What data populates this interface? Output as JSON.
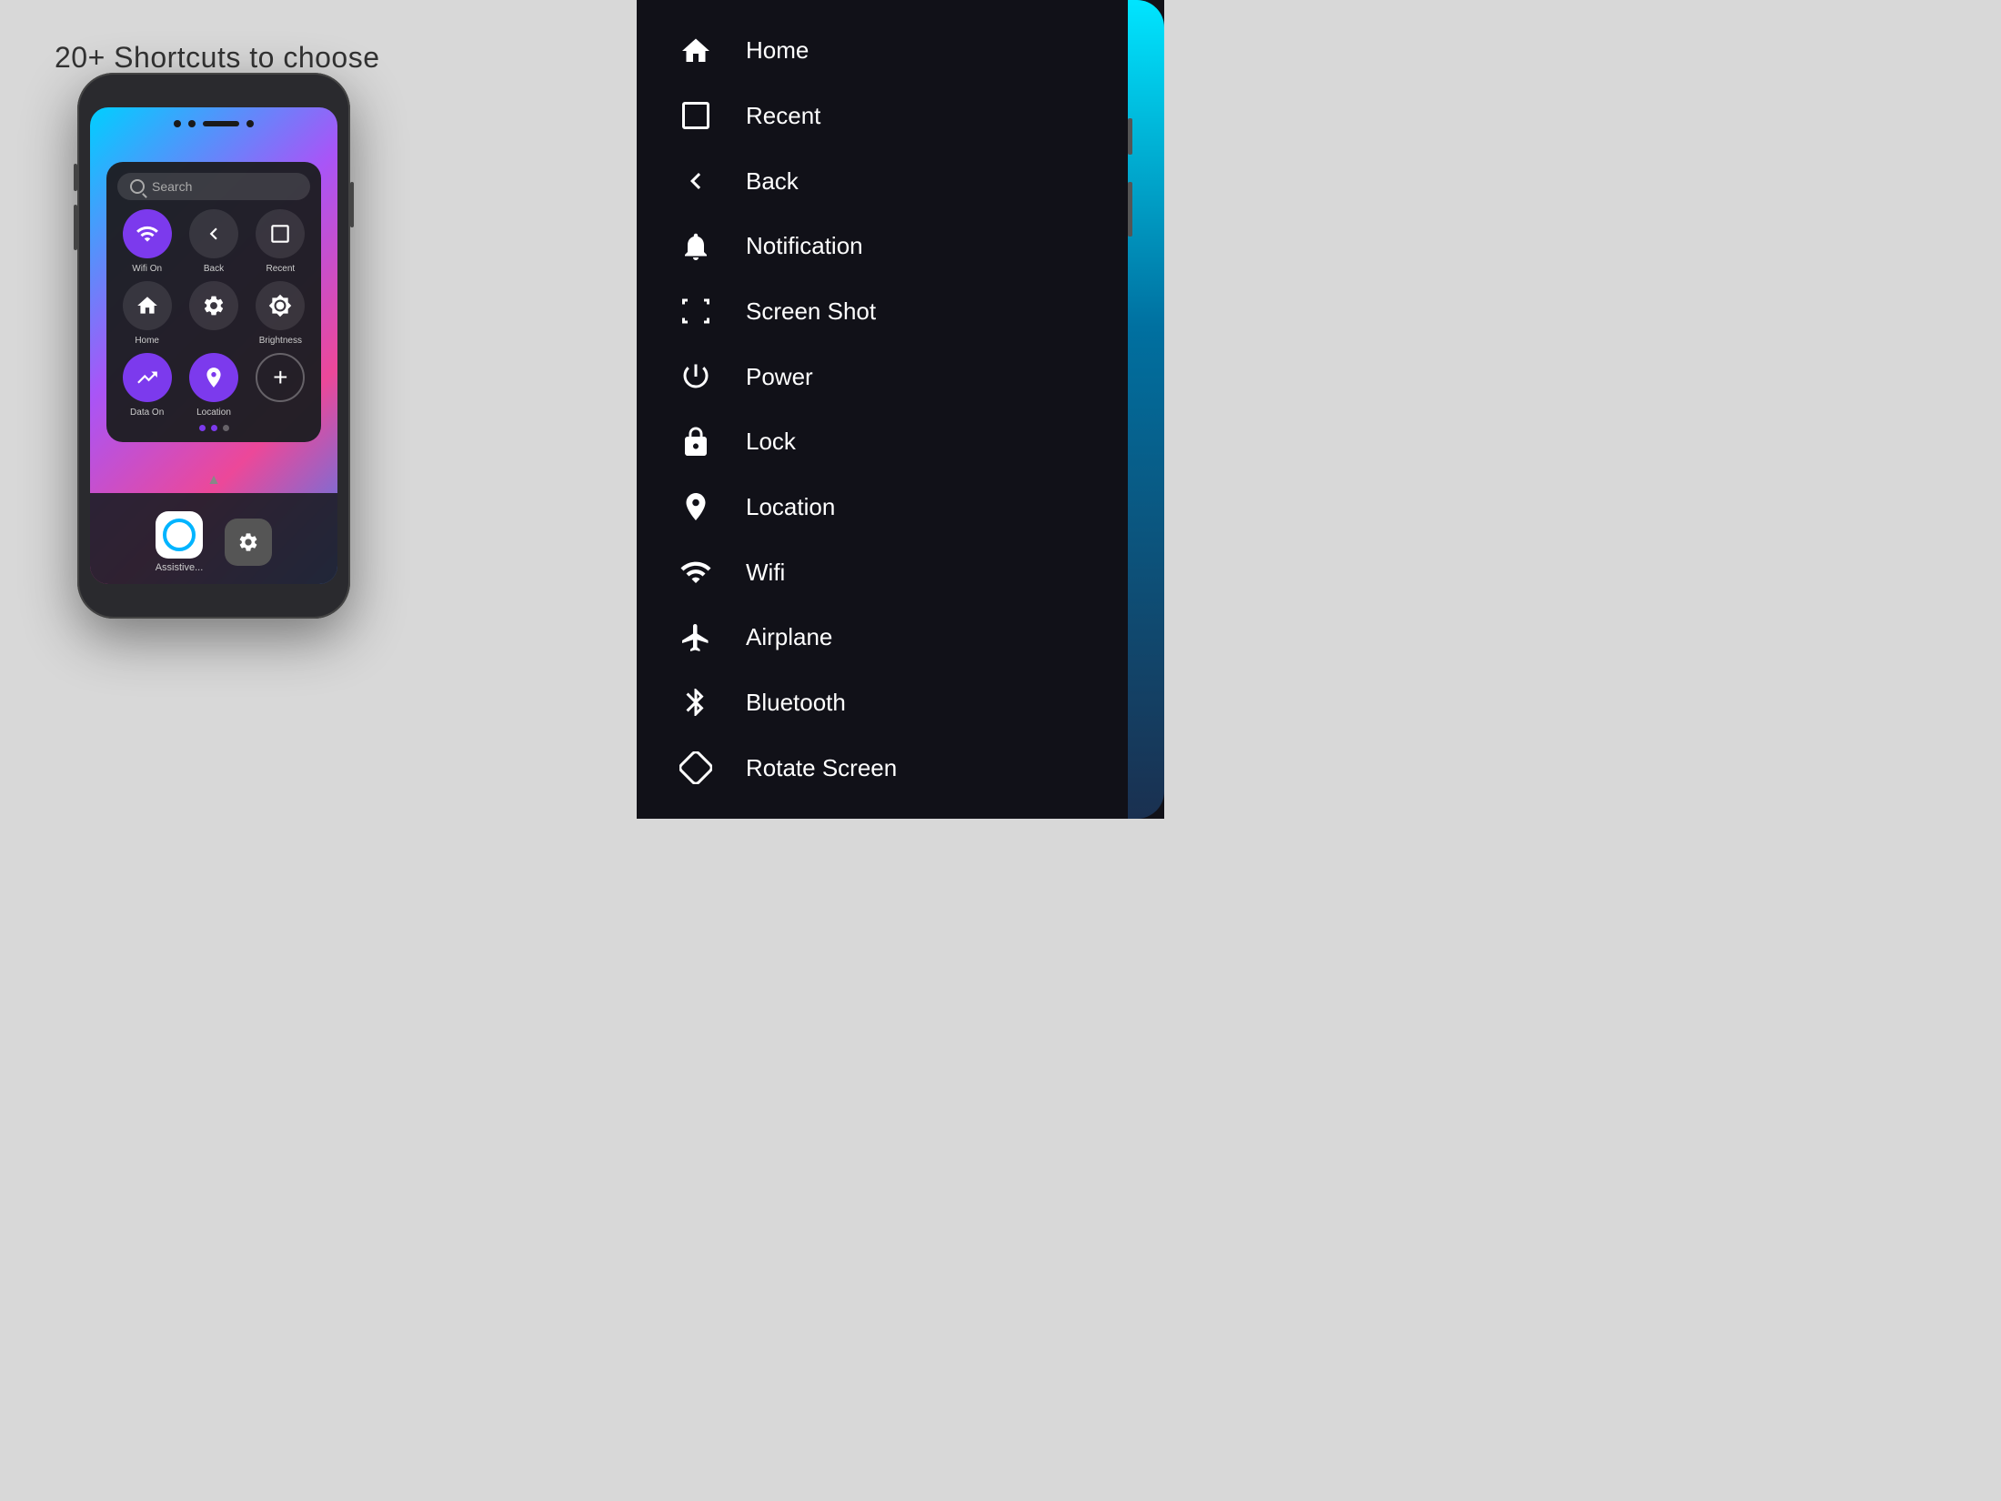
{
  "headline": "20+ Shortcuts to choose",
  "left_phone": {
    "search_placeholder": "Search",
    "shortcuts": [
      {
        "id": "wifi",
        "label": "Wifi On",
        "active": true,
        "icon": "wifi"
      },
      {
        "id": "back",
        "label": "Back",
        "active": false,
        "icon": "back"
      },
      {
        "id": "recent",
        "label": "Recent",
        "active": false,
        "icon": "recent"
      },
      {
        "id": "home",
        "label": "Home",
        "active": false,
        "icon": "home"
      },
      {
        "id": "settings",
        "label": "",
        "active": false,
        "icon": "settings"
      },
      {
        "id": "brightness",
        "label": "Brightness",
        "active": false,
        "icon": "brightness"
      },
      {
        "id": "data",
        "label": "Data On",
        "active": true,
        "icon": "data"
      },
      {
        "id": "location",
        "label": "Location",
        "active": true,
        "icon": "location"
      },
      {
        "id": "add",
        "label": "",
        "active": false,
        "icon": "add"
      }
    ],
    "dots": [
      true,
      true,
      false
    ],
    "app_label": "Assistive..."
  },
  "right_phone": {
    "shortcuts": [
      {
        "id": "home",
        "label": "Home",
        "icon": "home"
      },
      {
        "id": "recent",
        "label": "Recent",
        "icon": "recent"
      },
      {
        "id": "back",
        "label": "Back",
        "icon": "back"
      },
      {
        "id": "notification",
        "label": "Notification",
        "icon": "notification"
      },
      {
        "id": "screenshot",
        "label": "Screen Shot",
        "icon": "screenshot"
      },
      {
        "id": "power",
        "label": "Power",
        "icon": "power"
      },
      {
        "id": "lock",
        "label": "Lock",
        "icon": "lock"
      },
      {
        "id": "location",
        "label": "Location",
        "icon": "location"
      },
      {
        "id": "wifi",
        "label": "Wifi",
        "icon": "wifi"
      },
      {
        "id": "airplane",
        "label": "Airplane",
        "icon": "airplane"
      },
      {
        "id": "bluetooth",
        "label": "Bluetooth",
        "icon": "bluetooth"
      },
      {
        "id": "rotate",
        "label": "Rotate Screen",
        "icon": "rotate"
      }
    ]
  }
}
